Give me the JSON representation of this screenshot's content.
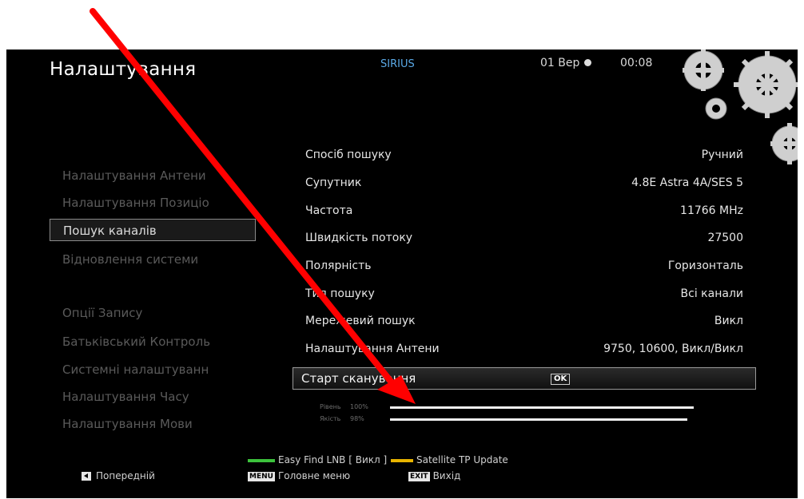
{
  "header": {
    "title": "Налаштування",
    "satellite": "SIRIUS",
    "date": "01 Вер",
    "time": "00:08"
  },
  "sidebar": {
    "items": [
      {
        "label": "Налаштування Антени",
        "active": false
      },
      {
        "label": "Налаштування Позиціо",
        "active": false
      },
      {
        "label": "Пошук каналів",
        "active": true
      },
      {
        "label": "Відновлення системи",
        "active": false
      },
      {
        "label": "Опції Запису",
        "active": false
      },
      {
        "label": "Батьківський Контроль",
        "active": false
      },
      {
        "label": "Системні налаштуванн",
        "active": false
      },
      {
        "label": "Налаштування Часу",
        "active": false
      },
      {
        "label": "Налаштування Мови",
        "active": false
      }
    ]
  },
  "settings": [
    {
      "label": "Спосіб пошуку",
      "value": "Ручний"
    },
    {
      "label": "Супутник",
      "value": "4.8E Astra 4A/SES 5"
    },
    {
      "label": "Частота",
      "value": "11766 MHz"
    },
    {
      "label": "Швидкість потоку",
      "value": "27500"
    },
    {
      "label": "Полярність",
      "value": "Горизонталь"
    },
    {
      "label": "Тип пошуку",
      "value": "Всі канали"
    },
    {
      "label": "Мережевий пошук",
      "value": "Викл"
    },
    {
      "label": "Налаштування Антени",
      "value": "9750, 10600, Викл/Викл"
    }
  ],
  "scan": {
    "label": "Старт сканування",
    "ok": "OK"
  },
  "signal": [
    {
      "name": "Рівень",
      "percent_label": "100%",
      "level": 1.0
    },
    {
      "name": "Якість",
      "percent_label": "98%",
      "level": 0.98
    }
  ],
  "footer": {
    "green_label": "Easy Find LNB [ Викл ]",
    "yellow_label": "Satellite TP Update",
    "prev_label": "Попередній",
    "menu_key": "MENU",
    "menu_label": "Головне меню",
    "exit_key": "EXIT",
    "exit_label": "Вихід"
  },
  "colors": {
    "green": "#3cc23c",
    "yellow": "#e8b400",
    "arrow": "#ff0000",
    "satellite": "#5aa9e6"
  },
  "icons": [
    "gears-icon",
    "clock-icon",
    "left-arrow-key-icon",
    "red-annotation-arrow-icon"
  ]
}
